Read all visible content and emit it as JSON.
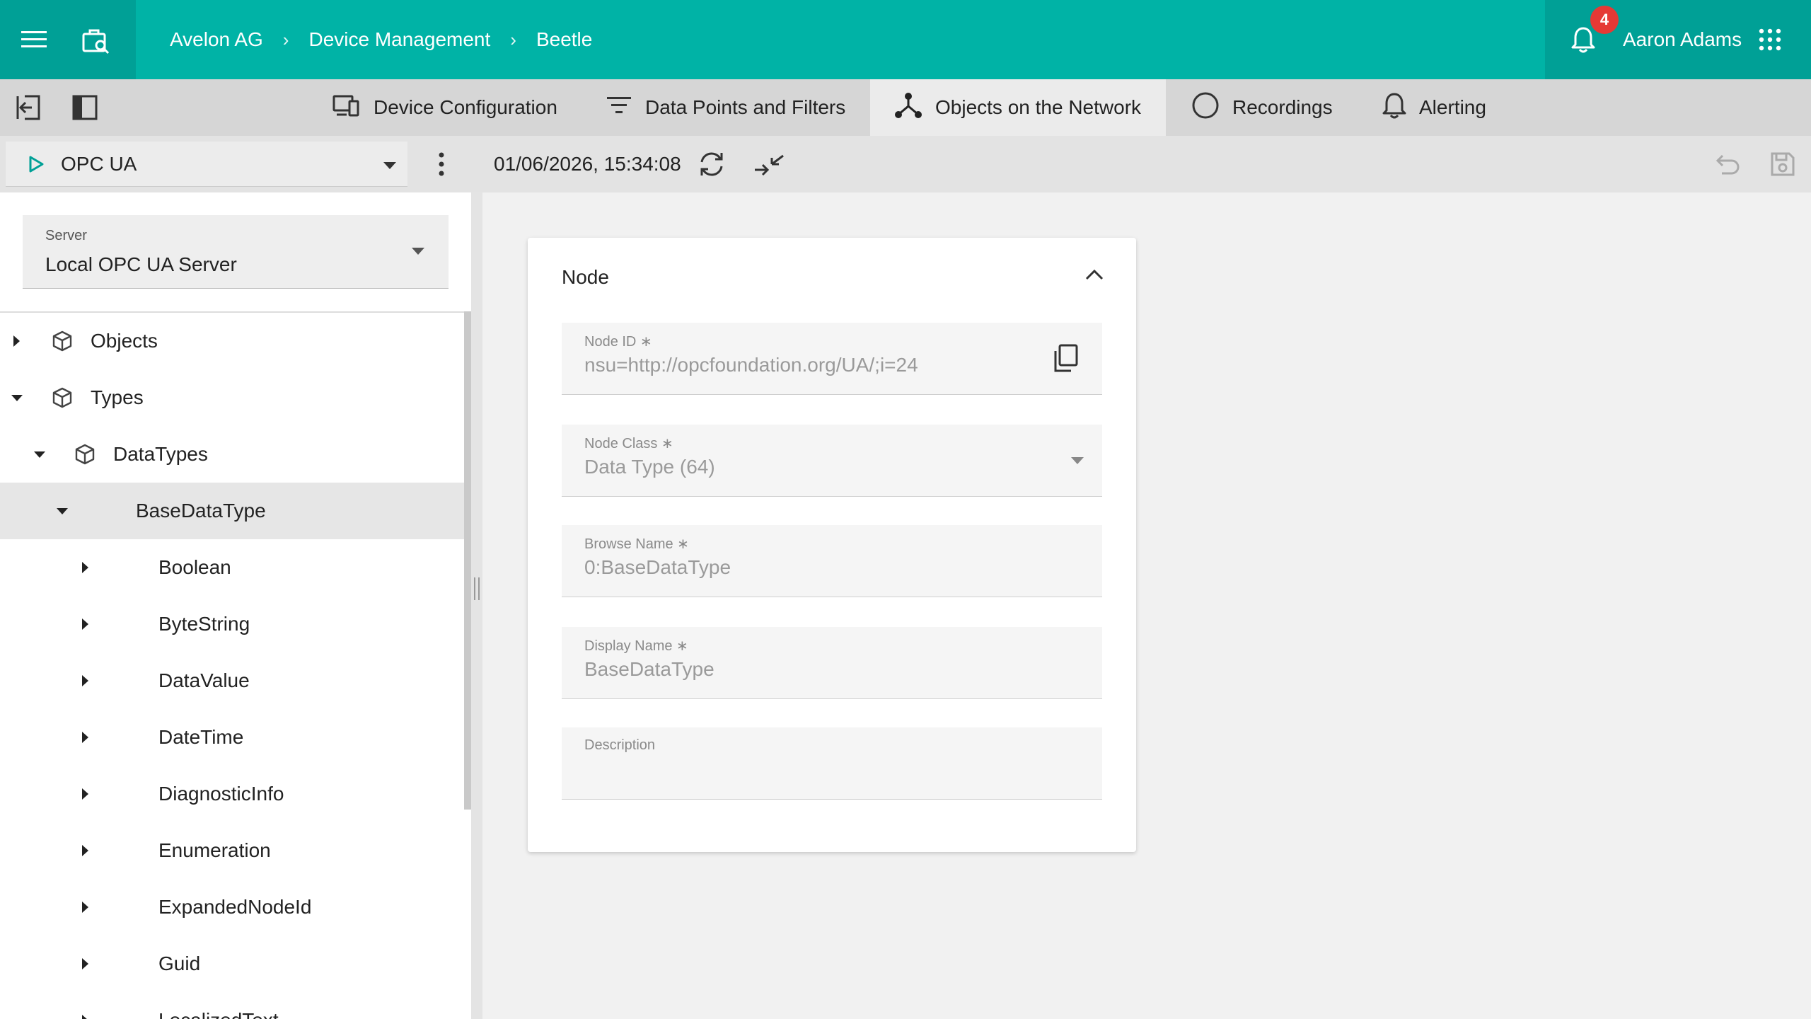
{
  "header": {
    "breadcrumb": [
      "Avelon AG",
      "Device Management",
      "Beetle"
    ],
    "breadcrumb_sep": "›",
    "notification_count": "4",
    "user_name": "Aaron Adams"
  },
  "tabs": [
    {
      "label": "Device Configuration",
      "icon": "devices-icon"
    },
    {
      "label": "Data Points and Filters",
      "icon": "filter-icon"
    },
    {
      "label": "Objects on the Network",
      "icon": "network-icon",
      "active": true
    },
    {
      "label": "Recordings",
      "icon": "circle-icon"
    },
    {
      "label": "Alerting",
      "icon": "bell-icon"
    }
  ],
  "toolbar": {
    "protocol": "OPC UA",
    "timestamp": "01/06/2026, 15:34:08"
  },
  "left_panel": {
    "server_label": "Server",
    "server_value": "Local OPC UA Server",
    "tree": [
      {
        "label": "Objects",
        "level": 0,
        "expanded": false,
        "icon": "cube-icon"
      },
      {
        "label": "Types",
        "level": 0,
        "expanded": true,
        "icon": "cube-icon"
      },
      {
        "label": "DataTypes",
        "level": 1,
        "expanded": true,
        "icon": "cube-icon"
      },
      {
        "label": "BaseDataType",
        "level": 2,
        "expanded": true,
        "selected": true
      },
      {
        "label": "Boolean",
        "level": 3,
        "expanded": false
      },
      {
        "label": "ByteString",
        "level": 3,
        "expanded": false
      },
      {
        "label": "DataValue",
        "level": 3,
        "expanded": false
      },
      {
        "label": "DateTime",
        "level": 3,
        "expanded": false
      },
      {
        "label": "DiagnosticInfo",
        "level": 3,
        "expanded": false
      },
      {
        "label": "Enumeration",
        "level": 3,
        "expanded": false
      },
      {
        "label": "ExpandedNodeId",
        "level": 3,
        "expanded": false
      },
      {
        "label": "Guid",
        "level": 3,
        "expanded": false
      },
      {
        "label": "LocalizedText",
        "level": 3,
        "expanded": false
      }
    ]
  },
  "node_card": {
    "title": "Node",
    "fields": {
      "node_id": {
        "label": "Node ID",
        "required": "∗",
        "value": "nsu=http://opcfoundation.org/UA/;i=24"
      },
      "node_class": {
        "label": "Node Class",
        "required": "∗",
        "value": "Data Type (64)"
      },
      "browse_name": {
        "label": "Browse Name",
        "required": "∗",
        "value": "0:BaseDataType"
      },
      "display_name": {
        "label": "Display Name",
        "required": "∗",
        "value": "BaseDataType"
      },
      "description": {
        "label": "Description",
        "value": ""
      }
    }
  },
  "colors": {
    "brand": "#00b3a6",
    "brand_dark": "#00a096",
    "badge": "#e53935"
  }
}
